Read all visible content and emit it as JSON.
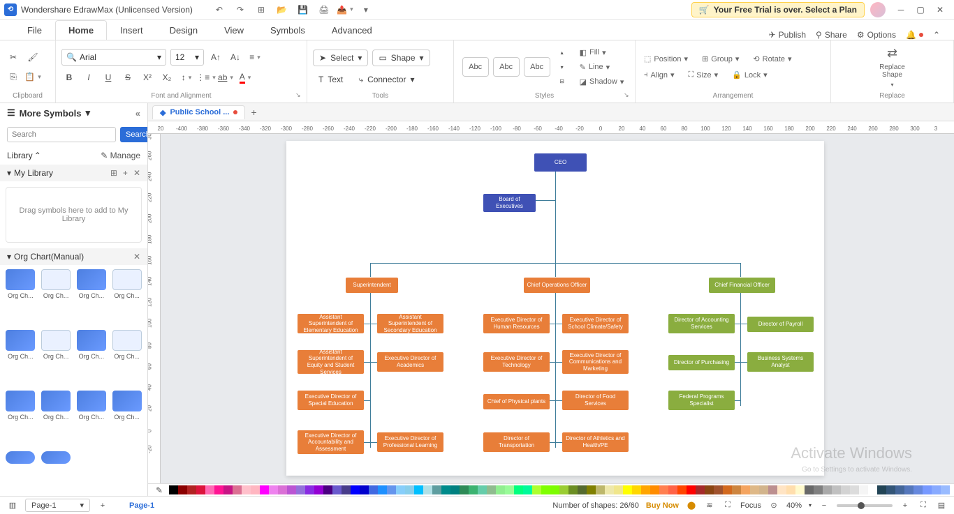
{
  "titlebar": {
    "app_name": "Wondershare EdrawMax (Unlicensed Version)",
    "trial_msg": "Your Free Trial is over. Select a Plan"
  },
  "menubar": {
    "tabs": [
      "File",
      "Home",
      "Insert",
      "Design",
      "View",
      "Symbols",
      "Advanced"
    ],
    "active": 1,
    "publish": "Publish",
    "share": "Share",
    "options": "Options"
  },
  "ribbon": {
    "clipboard": "Clipboard",
    "font_align": "Font and Alignment",
    "font_name": "Arial",
    "font_size": "12",
    "tools": "Tools",
    "select": "Select",
    "shape": "Shape",
    "text": "Text",
    "connector": "Connector",
    "styles": "Styles",
    "abc": "Abc",
    "fill": "Fill",
    "line": "Line",
    "shadow": "Shadow",
    "arrangement": "Arrangement",
    "position": "Position",
    "align": "Align",
    "group": "Group",
    "size": "Size",
    "rotate": "Rotate",
    "lock": "Lock",
    "replace": "Replace",
    "replace_shape": "Replace\nShape"
  },
  "sidebar": {
    "more_symbols": "More Symbols",
    "search_ph": "Search",
    "search_btn": "Search",
    "library": "Library",
    "manage": "Manage",
    "my_library": "My Library",
    "my_lib_hint": "Drag symbols here to add to My Library",
    "org_chart": "Org Chart(Manual)",
    "shape_label": "Org Ch..."
  },
  "document": {
    "tab_name": "Public School ..."
  },
  "ruler_h": [
    "20",
    "-400",
    "-380",
    "-360",
    "-340",
    "-320",
    "-300",
    "-280",
    "-260",
    "-240",
    "-220",
    "-200",
    "-180",
    "-160",
    "-140",
    "-120",
    "-100",
    "-80",
    "-60",
    "-40",
    "-20",
    "0",
    "20",
    "40",
    "60",
    "80",
    "100",
    "120",
    "140",
    "160",
    "180",
    "200",
    "220",
    "240",
    "260",
    "280",
    "300",
    "3"
  ],
  "ruler_v": [
    "30",
    "260",
    "240",
    "220",
    "200",
    "180",
    "160",
    "140",
    "120",
    "100",
    "80",
    "60",
    "40",
    "20",
    "0",
    "-20"
  ],
  "org_chart": {
    "ceo": "CEO",
    "board": "Board of Executives",
    "super": "Superintendent",
    "coo": "Chief Operations Officer",
    "cfo": "Chief Financial Officer",
    "s1a": "Assistant Superintendent of Elementary Education",
    "s1b": "Assistant Superintendent of Secondary Education",
    "s2a": "Assistant Superintendent of Equity and Student Services",
    "s2b": "Executive Director of Academics",
    "s3a": "Executive Director of Special Education",
    "s4a": "Executive Director of Accountability and Assessment",
    "s4b": "Executive Director of Professional Learning",
    "o1a": "Executive Director of Human Resources",
    "o1b": "Executive Director of School Climate/Safety",
    "o2a": "Executive Director of Technology",
    "o2b": "Executive Director of Communications and Marketing",
    "o3a": "Chief of Physical plants",
    "o3b": "Director of Food Services",
    "o4a": "Director of Transportation",
    "o4b": "Director of Athletics and Health/PE",
    "f1a": "Director of Accounting Services",
    "f1b": "Director of Payroll",
    "f2a": "Director of Purchasing",
    "f2b": "Business Systems Analyst",
    "f3a": "Federal Programs Specialist"
  },
  "color_strip": [
    "#000000",
    "#8b0000",
    "#b22222",
    "#dc143c",
    "#ff69b4",
    "#ff1493",
    "#c71585",
    "#db7093",
    "#ffc0cb",
    "#ffb6c1",
    "#ff00ff",
    "#ee82ee",
    "#da70d6",
    "#ba55d3",
    "#9370db",
    "#8a2be2",
    "#9400d3",
    "#4b0082",
    "#6a5acd",
    "#483d8b",
    "#0000ff",
    "#0000cd",
    "#4169e1",
    "#1e90ff",
    "#6495ed",
    "#87cefa",
    "#87ceeb",
    "#00bfff",
    "#b0e0e6",
    "#5f9ea0",
    "#008b8b",
    "#008080",
    "#2e8b57",
    "#3cb371",
    "#66cdaa",
    "#8fbc8f",
    "#90ee90",
    "#98fb98",
    "#00ff7f",
    "#00fa9a",
    "#adff2f",
    "#7fff00",
    "#7cfc00",
    "#9acd32",
    "#6b8e23",
    "#556b2f",
    "#808000",
    "#bdb76b",
    "#eee8aa",
    "#f0e68c",
    "#ffff00",
    "#ffd700",
    "#ffa500",
    "#ff8c00",
    "#ff7f50",
    "#ff6347",
    "#ff4500",
    "#ff0000",
    "#a52a2a",
    "#8b4513",
    "#a0522d",
    "#d2691e",
    "#cd853f",
    "#f4a460",
    "#deb887",
    "#d2b48c",
    "#bc8f8f",
    "#ffe4c4",
    "#ffdead",
    "#fffacd",
    "#696969",
    "#808080",
    "#a9a9a9",
    "#c0c0c0",
    "#d3d3d3",
    "#dcdcdc",
    "#f5f5f5",
    "#ffffff",
    "#245",
    "#357",
    "#469",
    "#57b",
    "#68d",
    "#79f",
    "#8af",
    "#9bf"
  ],
  "status": {
    "page": "Page-1",
    "page_tab": "Page-1",
    "shapes": "Number of shapes: 26/60",
    "buy": "Buy Now",
    "focus": "Focus",
    "zoom": "40%"
  },
  "watermark": {
    "main": "Activate Windows",
    "sub": "Go to Settings to activate Windows."
  }
}
